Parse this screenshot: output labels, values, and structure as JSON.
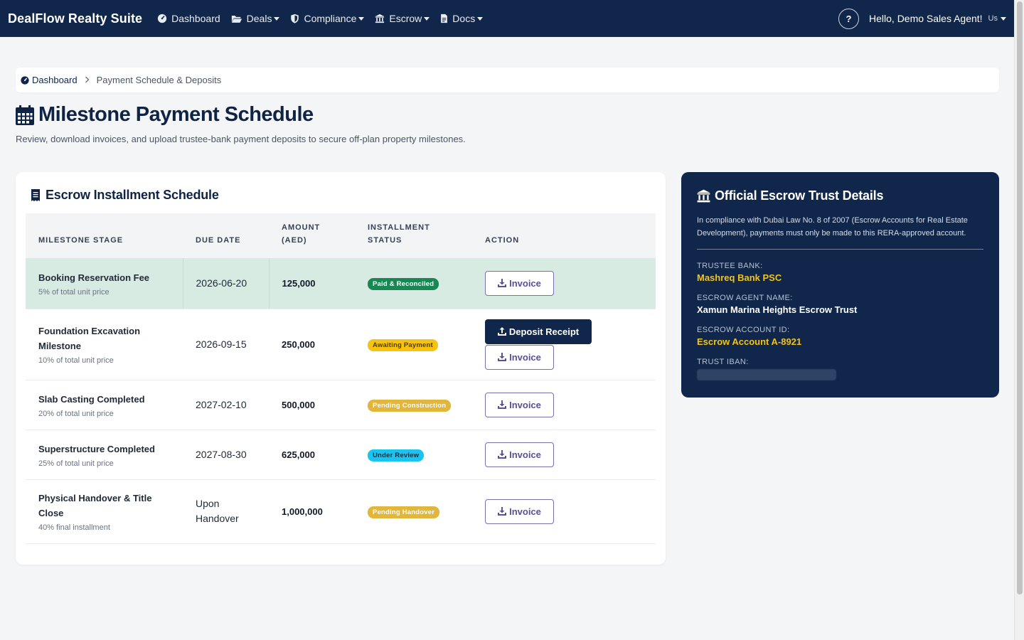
{
  "nav": {
    "brand": "DealFlow Realty Suite",
    "items": [
      {
        "label": "Dashboard",
        "icon": "dashboard-icon",
        "dropdown": false
      },
      {
        "label": "Deals",
        "icon": "folder-icon",
        "dropdown": true
      },
      {
        "label": "Compliance",
        "icon": "shield-icon",
        "dropdown": true
      },
      {
        "label": "Escrow",
        "icon": "bank-icon",
        "dropdown": true
      },
      {
        "label": "Docs",
        "icon": "file-icon",
        "dropdown": true
      }
    ],
    "help": "?",
    "greeting": "Hello, Demo Sales Agent!",
    "avatar_alt": "Us"
  },
  "breadcrumb": {
    "home": "Dashboard",
    "separator": ">",
    "current": "Payment Schedule & Deposits"
  },
  "page": {
    "title": "Milestone Payment Schedule",
    "subtitle": "Review, download invoices, and upload trustee-bank payment deposits to secure off-plan property milestones."
  },
  "schedule": {
    "title": "Escrow Installment Schedule",
    "headers": {
      "stage": "Milestone Stage",
      "due": "Due Date",
      "amount_1": "Amount",
      "amount_2": "(AED)",
      "status_1": "Installment",
      "status_2": "Status",
      "action": "Action"
    },
    "rows": [
      {
        "stage": "Booking Reservation Fee",
        "sub": "5% of total unit price",
        "due": "2026-06-20",
        "amount": "125,000",
        "status": "Paid & Reconciled",
        "status_type": "paid",
        "invoice": "Invoice"
      },
      {
        "stage": "Foundation Excavation Milestone",
        "sub": "10% of total unit price",
        "due": "2026-09-15",
        "amount": "250,000",
        "status": "Awaiting Payment",
        "status_type": "awaiting",
        "deposit": "Deposit Receipt",
        "invoice": "Invoice"
      },
      {
        "stage": "Slab Casting Completed",
        "sub": "20% of total unit price",
        "due": "2027-02-10",
        "amount": "500,000",
        "status": "Pending Construction",
        "status_type": "pending",
        "invoice": "Invoice"
      },
      {
        "stage": "Superstructure Completed",
        "sub": "25% of total unit price",
        "due": "2027-08-30",
        "amount": "625,000",
        "status": "Under Review",
        "status_type": "review",
        "invoice": "Invoice"
      },
      {
        "stage": "Physical Handover & Title Close",
        "sub": "40% final installment",
        "due": "Upon Handover",
        "amount": "1,000,000",
        "status": "Pending Handover",
        "status_type": "pending",
        "invoice": "Invoice"
      }
    ]
  },
  "escrow": {
    "title": "Official Escrow Trust Details",
    "note": "In compliance with Dubai Law No. 8 of 2007 (Escrow Accounts for Real Estate Development), payments must only be made to this RERA-approved account.",
    "bank_label": "TRUSTEE BANK:",
    "bank": "Mashreq Bank PSC",
    "agent_label": "ESCROW AGENT NAME:",
    "agent": "Xamun Marina Heights Escrow Trust",
    "account_label": "ESCROW ACCOUNT ID:",
    "account": "Escrow Account A-8921",
    "iban_label": "TRUST IBAN:"
  },
  "colors": {
    "navy": "#10264a",
    "gold": "#f2c318",
    "paid_row": "#d7ebe2",
    "paid_badge": "#198754",
    "review_badge": "#19c4f0",
    "awaiting_badge": "#f7c313",
    "pending_badge": "#e2b53b"
  }
}
